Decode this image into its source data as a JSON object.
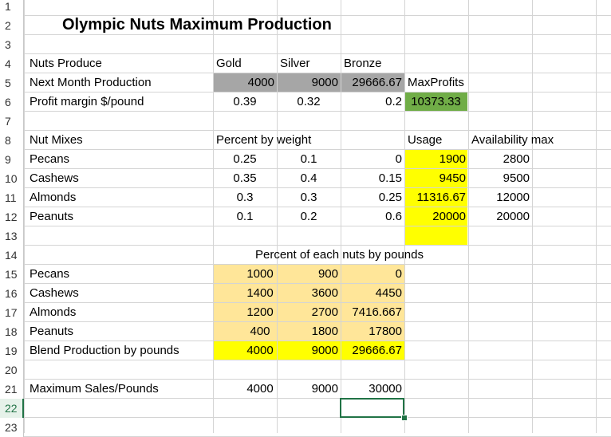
{
  "rows": [
    "1",
    "2",
    "3",
    "4",
    "5",
    "6",
    "7",
    "8",
    "9",
    "10",
    "11",
    "12",
    "13",
    "14",
    "15",
    "16",
    "17",
    "18",
    "19",
    "20",
    "21",
    "22",
    "23"
  ],
  "title": "Olympic Nuts Maximum Production",
  "labels": {
    "nuts_produce": "Nuts Produce",
    "gold": "Gold",
    "silver": "Silver",
    "bronze": "Bronze",
    "next_month": "Next Month Production",
    "maxprofits": "MaxProfits",
    "profit_margin": "Profit margin $/pound",
    "nut_mixes": "Nut Mixes",
    "percent_by_weight": "Percent by weight",
    "usage": "Usage",
    "availability_max": "Availability max",
    "percent_each": "Percent of each nuts by pounds",
    "blend": "Blend Production by pounds",
    "max_sales": "Maximum Sales/Pounds"
  },
  "production": [
    "4000",
    "9000",
    "29666.67"
  ],
  "profit_margin": [
    "0.39",
    "0.32",
    "0.2"
  ],
  "max_profits_value": "10373.33",
  "mix_rows": [
    {
      "name": "Pecans",
      "pct": [
        "0.25",
        "0.1",
        "0"
      ],
      "usage": "1900",
      "avail": "2800"
    },
    {
      "name": "Cashews",
      "pct": [
        "0.35",
        "0.4",
        "0.15"
      ],
      "usage": "9450",
      "avail": "9500"
    },
    {
      "name": "Almonds",
      "pct": [
        "0.3",
        "0.3",
        "0.25"
      ],
      "usage": "11316.67",
      "avail": "12000"
    },
    {
      "name": "Peanuts",
      "pct": [
        "0.1",
        "0.2",
        "0.6"
      ],
      "usage": "20000",
      "avail": "20000"
    }
  ],
  "pound_rows": [
    {
      "name": "Pecans",
      "vals": [
        "1000",
        "900",
        "0"
      ]
    },
    {
      "name": "Cashews",
      "vals": [
        "1400",
        "3600",
        "4450"
      ]
    },
    {
      "name": "Almonds",
      "vals": [
        "1200",
        "2700",
        "7416.667"
      ]
    },
    {
      "name": "Peanuts",
      "vals": [
        "400",
        "1800",
        "17800"
      ]
    }
  ],
  "blend": [
    "4000",
    "9000",
    "29666.67"
  ],
  "max_sales": [
    "4000",
    "9000",
    "30000"
  ],
  "colors": {
    "gray_fill": "#a6a6a6",
    "green_fill": "#70ad47",
    "yellow_fill": "#ffff00",
    "tan_fill": "#ffe699",
    "grid": "#d4d4d4",
    "selection": "#217346"
  },
  "selected_row": "22"
}
